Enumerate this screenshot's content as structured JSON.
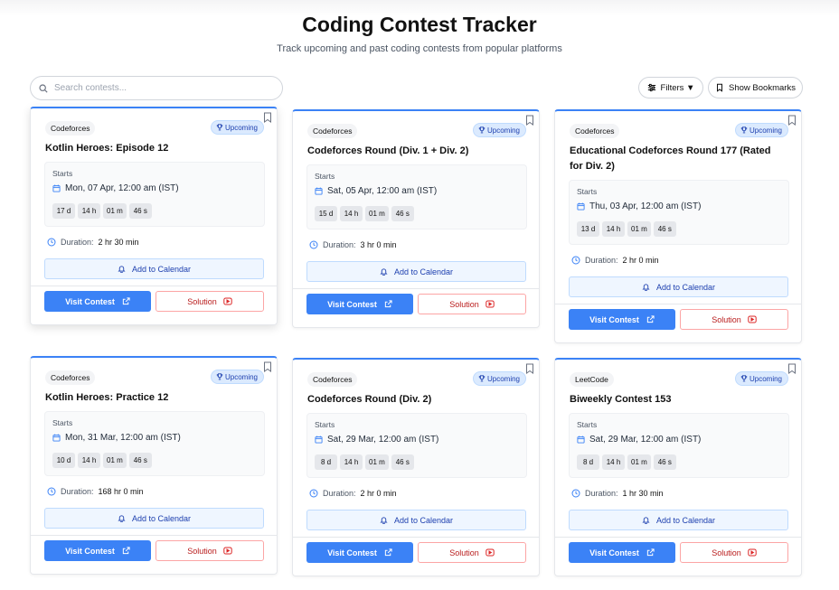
{
  "header": {
    "title": "Coding Contest Tracker",
    "subtitle": "Track upcoming and past coding contests from popular platforms"
  },
  "search": {
    "placeholder": "Search contests..."
  },
  "toolbar": {
    "filters_label": "Filters ▼",
    "bookmarks_label": "Show Bookmarks"
  },
  "labels": {
    "starts": "Starts",
    "duration_prefix": "Duration:",
    "add_to_calendar": "Add to Calendar",
    "visit_contest": "Visit Contest",
    "solution": "Solution"
  },
  "colors": {
    "accent": "#3b82f6",
    "badge_bg": "#dbeafe",
    "solution_red": "#b91c1c"
  },
  "contests": [
    {
      "platform": "Codeforces",
      "status": "Upcoming",
      "name": "Kotlin Heroes: Episode 12",
      "start": "Mon, 07 Apr, 12:00 am (IST)",
      "countdown": [
        "17 d",
        "14 h",
        "01 m",
        "46 s"
      ],
      "duration": "2 hr 30 min"
    },
    {
      "platform": "Codeforces",
      "status": "Upcoming",
      "name": "Codeforces Round (Div. 1 + Div. 2)",
      "start": "Sat, 05 Apr, 12:00 am (IST)",
      "countdown": [
        "15 d",
        "14 h",
        "01 m",
        "46 s"
      ],
      "duration": "3 hr 0 min"
    },
    {
      "platform": "Codeforces",
      "status": "Upcoming",
      "name": "Educational Codeforces Round 177 (Rated for Div. 2)",
      "start": "Thu, 03 Apr, 12:00 am (IST)",
      "countdown": [
        "13 d",
        "14 h",
        "01 m",
        "46 s"
      ],
      "duration": "2 hr 0 min"
    },
    {
      "platform": "Codeforces",
      "status": "Upcoming",
      "name": "Kotlin Heroes: Practice 12",
      "start": "Mon, 31 Mar, 12:00 am (IST)",
      "countdown": [
        "10 d",
        "14 h",
        "01 m",
        "46 s"
      ],
      "duration": "168 hr 0 min"
    },
    {
      "platform": "Codeforces",
      "status": "Upcoming",
      "name": "Codeforces Round (Div. 2)",
      "start": "Sat, 29 Mar, 12:00 am (IST)",
      "countdown": [
        "8 d",
        "14 h",
        "01 m",
        "46 s"
      ],
      "duration": "2 hr 0 min"
    },
    {
      "platform": "LeetCode",
      "status": "Upcoming",
      "name": "Biweekly Contest 153",
      "start": "Sat, 29 Mar, 12:00 am (IST)",
      "countdown": [
        "8 d",
        "14 h",
        "01 m",
        "46 s"
      ],
      "duration": "1 hr 30 min"
    }
  ]
}
